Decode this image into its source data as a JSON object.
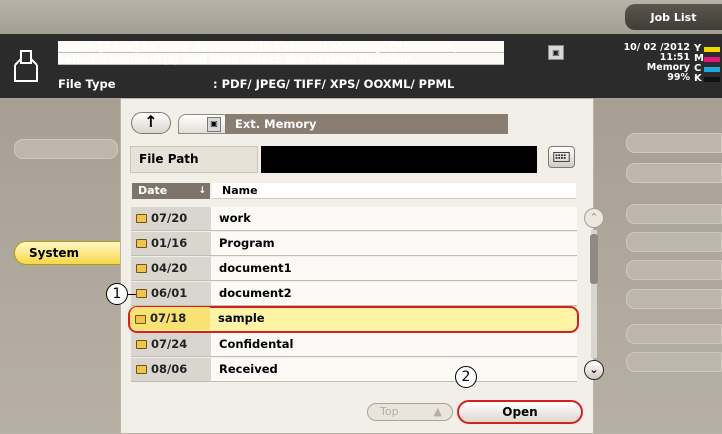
{
  "header": {
    "job_list_label": "Job List"
  },
  "message": {
    "line1": "Touch [Save] to save document in External Memory. Otherwise,",
    "line2": "select document(s) and then select the desired function.",
    "file_type_label": "File Type",
    "file_type_value": ": PDF/ JPEG/ TIFF/ XPS/ OOXML/ PPML"
  },
  "status": {
    "date": "10/ 02 /2012",
    "time": "11:51",
    "memory_label": "Memory",
    "memory_value": "99%"
  },
  "toner": [
    {
      "label": "Y",
      "color": "#f2d600"
    },
    {
      "label": "M",
      "color": "#e0157e"
    },
    {
      "label": "C",
      "color": "#22a6e0"
    },
    {
      "label": "K",
      "color": "#111111"
    }
  ],
  "left_tabs": {
    "system_label": "System"
  },
  "navigator": {
    "location": "Ext. Memory"
  },
  "file_path": {
    "label": "File Path",
    "value": ""
  },
  "list": {
    "date_header": "Date",
    "sort_arrow": "↓",
    "name_header": "Name",
    "rows": [
      {
        "date": "07/20",
        "name": "work"
      },
      {
        "date": "01/16",
        "name": "Program"
      },
      {
        "date": "04/20",
        "name": "document1"
      },
      {
        "date": "06/01",
        "name": "document2"
      },
      {
        "date": "07/18",
        "name": "sample",
        "selected": true
      },
      {
        "date": "07/24",
        "name": "Confidental"
      },
      {
        "date": "08/06",
        "name": "Received"
      }
    ]
  },
  "buttons": {
    "top_label": "Top",
    "open_label": "Open"
  },
  "callouts": [
    "1",
    "2"
  ],
  "colors": {
    "highlight": "#d62020",
    "selection": "#fff4a6",
    "system_tab": "#f7d84a"
  }
}
